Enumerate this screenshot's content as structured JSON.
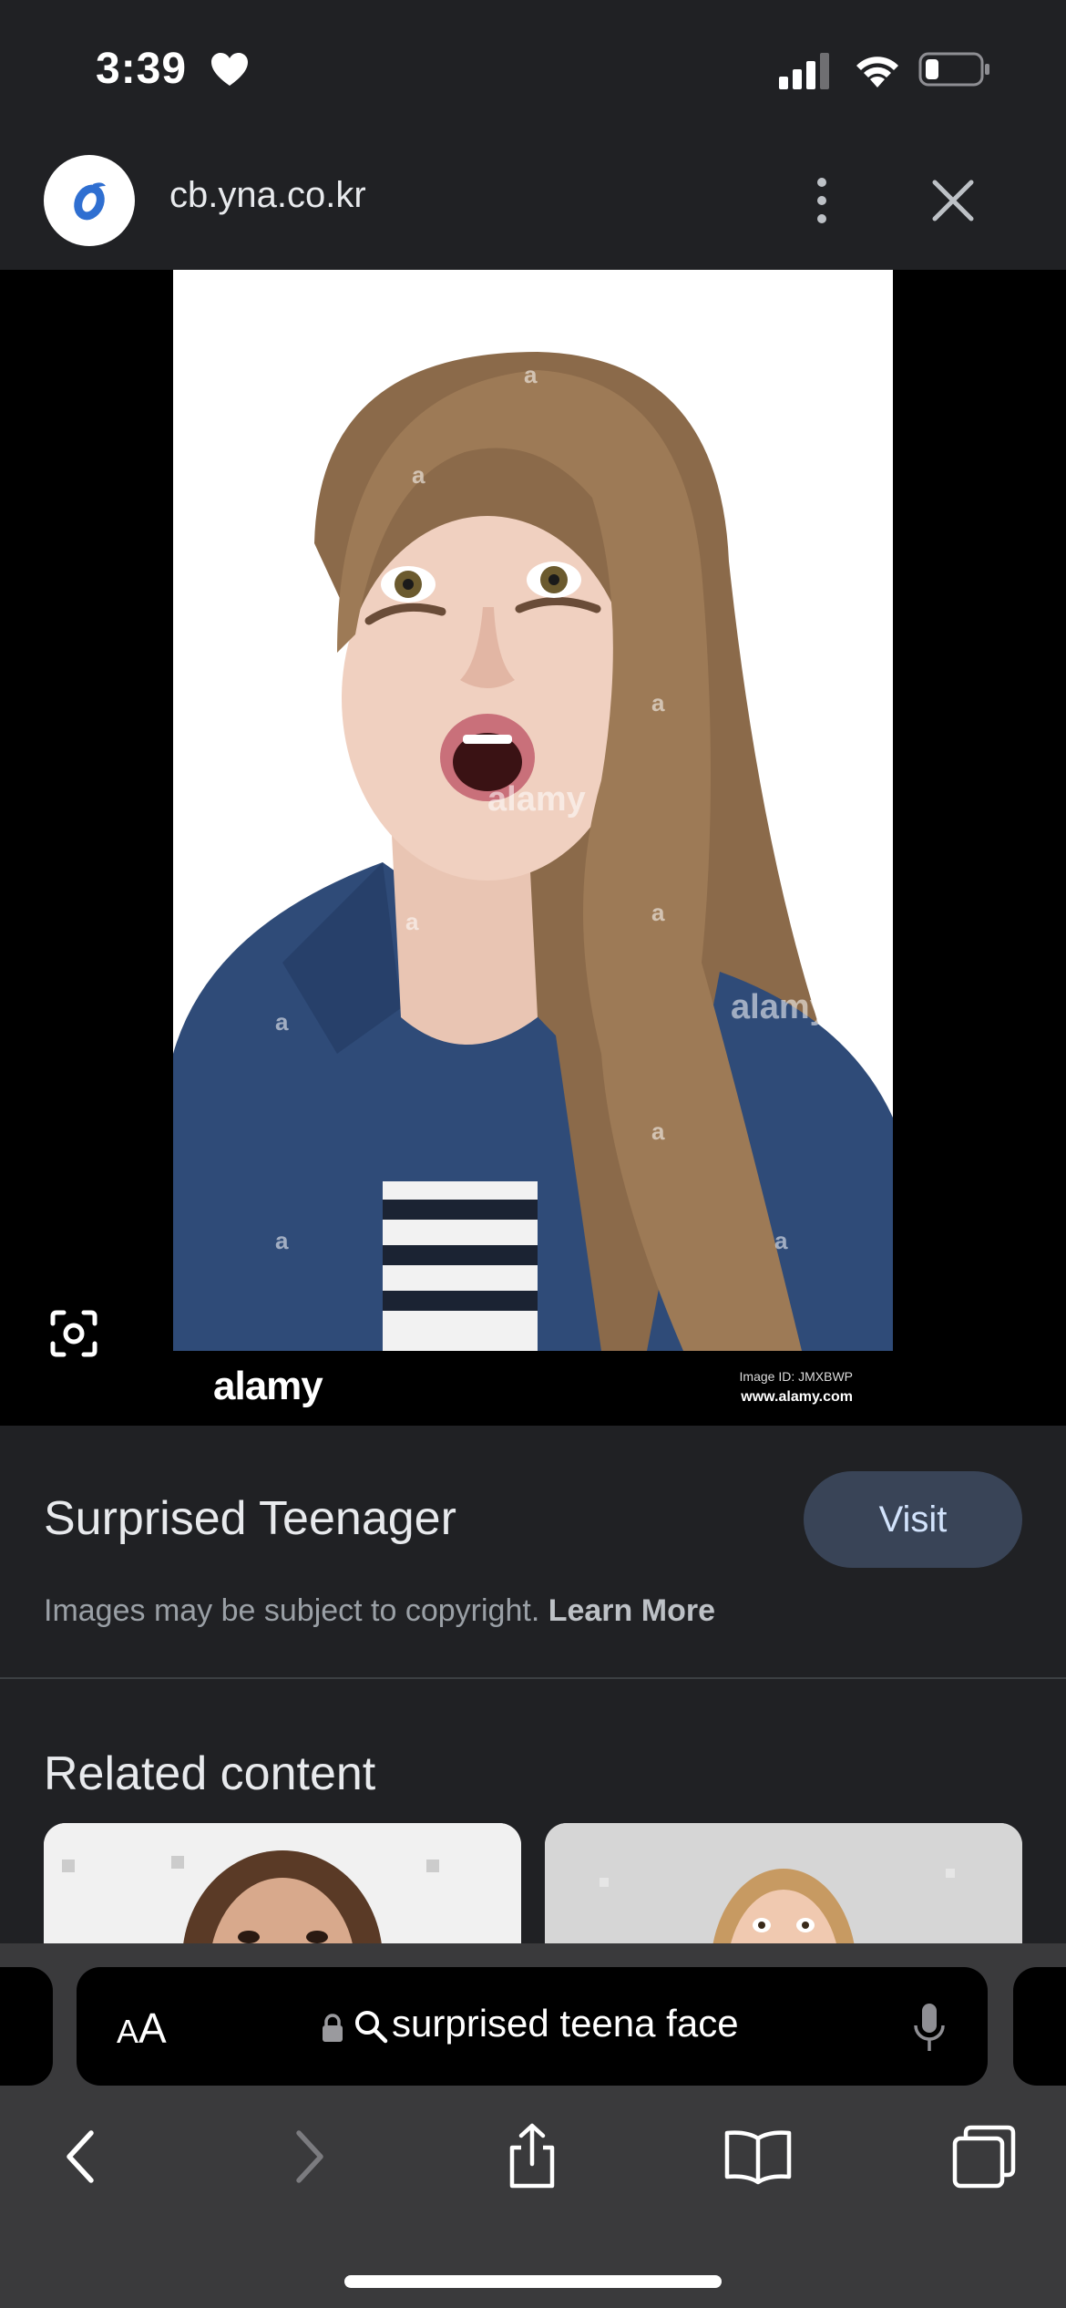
{
  "status_bar": {
    "time": "3:39",
    "icons": [
      "heart-icon",
      "cellular-signal-icon",
      "wifi-icon",
      "battery-icon"
    ]
  },
  "header": {
    "domain": "cb.yna.co.kr",
    "logo_icon": "site-logo",
    "more_icon": "more-vertical-icon",
    "close_icon": "close-icon"
  },
  "image": {
    "watermark_text": "alamy",
    "watermark_mark": "a",
    "footer_brand": "alamy",
    "footer_image_id": "Image ID: JMXBWP",
    "footer_url": "www.alamy.com",
    "lens_icon": "lens-icon"
  },
  "info": {
    "title": "Surprised Teenager",
    "visit_label": "Visit",
    "copyright_text": "Images may be subject to copyright.",
    "learn_more_label": "Learn More"
  },
  "related": {
    "heading": "Related content"
  },
  "toolbar": {
    "text_size_small": "A",
    "text_size_large": "A",
    "search_query": "surprised teena face",
    "icons": [
      "lock-icon",
      "search-icon",
      "microphone-icon",
      "back-icon",
      "forward-icon",
      "share-icon",
      "bookmarks-icon",
      "tabs-icon"
    ]
  },
  "colors": {
    "background": "#202124",
    "visit_button_bg": "#394457",
    "visit_button_text": "#d2e3fc",
    "toolbar_bg": "#3a3a3c",
    "secondary_text": "#9aa0a6"
  }
}
